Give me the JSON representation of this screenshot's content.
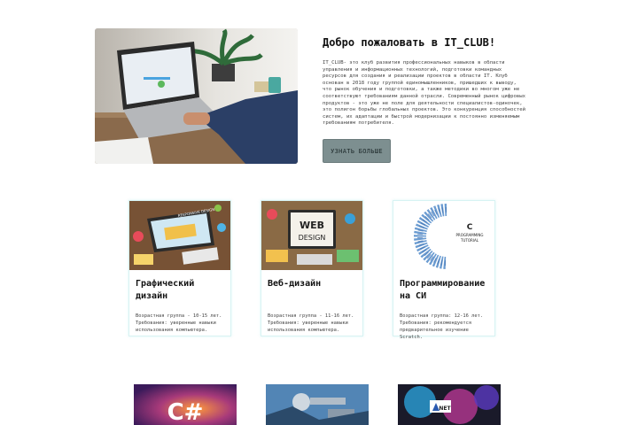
{
  "hero": {
    "title": "Добро пожаловать в IT_CLUB!",
    "body": "IT_CLUB- это клуб развития профессиональных навыков в области управления и информационных технологий, подготовки командных ресурсов для создания и реализации проектов в области IT. Клуб основан в 2018 году группой единомышленников, пришедших к выводу, что рынок обучения и подготовки, а также методики во многом уже не соответствуют требованиям данной отрасли. Современный рынок цифровых продуктов - это уже не поле для деятельности специалистов-одиночек, это полигон борьбы глобальных проектов. Это конкуренция способностей систем, их адаптации и быстрой модернизации к постоянно изменяемым требованиям потребителя.",
    "button_label": "УЗНАТЬ БОЛЬШЕ"
  },
  "cards": [
    {
      "title": "Графический дизайн",
      "age": "Возрастная группа - 10-15 лет.",
      "req": "Требования: уверенные навыки использования компьютера.",
      "thumb_text": "RESPONSIVE DESIGN"
    },
    {
      "title": "Веб-дизайн",
      "age": "Возрастная группа - 11-16 лет.",
      "req": "Требования: уверенные навыки использования компьютера.",
      "thumb_text_1": "WEB",
      "thumb_text_2": "DESIGN"
    },
    {
      "title": "Программирование на СИ",
      "age": "Возрастная группа: 12-16 лет.",
      "req": "Требования: рекомендуется предварительное изучение Scratch.",
      "thumb_text_1": "C",
      "thumb_text_2": "PROGRAMMING",
      "thumb_text_3": "TUTORIAL"
    }
  ],
  "bottom": {
    "csharp_label": "C#",
    "dotnet_label": "NET"
  }
}
